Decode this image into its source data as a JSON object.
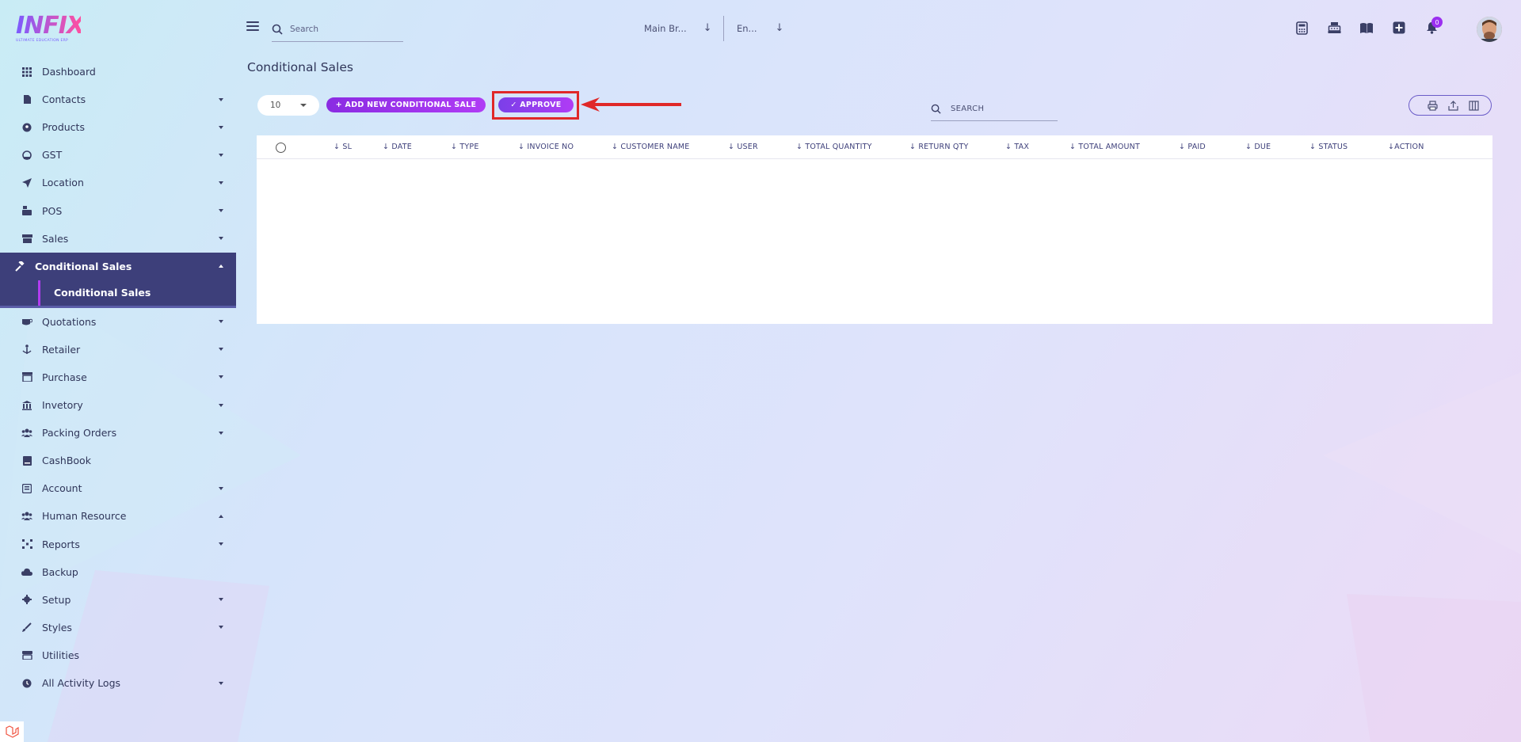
{
  "brand": {
    "name": "INFIX",
    "tagline": "ULTIMATE EDUCATION ERP"
  },
  "topbar": {
    "search_placeholder": "Search",
    "branch": "Main Br...",
    "language": "En...",
    "notification_count": "0",
    "icons": [
      "calculator-icon",
      "cash-register-icon",
      "book-icon",
      "plus-square-icon",
      "bell-icon"
    ]
  },
  "sidebar": {
    "items": [
      {
        "label": "Dashboard",
        "icon": "grid-icon",
        "has_caret": false
      },
      {
        "label": "Contacts",
        "icon": "contact-icon",
        "has_caret": true
      },
      {
        "label": "Products",
        "icon": "product-icon",
        "has_caret": true
      },
      {
        "label": "GST",
        "icon": "gst-icon",
        "has_caret": true
      },
      {
        "label": "Location",
        "icon": "location-icon",
        "has_caret": true
      },
      {
        "label": "POS",
        "icon": "pos-icon",
        "has_caret": true
      },
      {
        "label": "Sales",
        "icon": "sales-icon",
        "has_caret": true
      },
      {
        "label": "Conditional Sales",
        "icon": "gavel-icon",
        "active": true,
        "expanded": true
      },
      {
        "label": "Quotations",
        "icon": "quotation-icon",
        "has_caret": true
      },
      {
        "label": "Retailer",
        "icon": "retailer-icon",
        "has_caret": true
      },
      {
        "label": "Purchase",
        "icon": "purchase-icon",
        "has_caret": true
      },
      {
        "label": "Invetory",
        "icon": "inventory-icon",
        "has_caret": true
      },
      {
        "label": "Packing Orders",
        "icon": "users-icon",
        "has_caret": true
      },
      {
        "label": "CashBook",
        "icon": "cashbook-icon",
        "has_caret": false
      },
      {
        "label": "Account",
        "icon": "account-icon",
        "has_caret": true
      },
      {
        "label": "Human Resource",
        "icon": "users-icon",
        "has_caret": true,
        "caret_up": true
      },
      {
        "label": "Reports",
        "icon": "reports-icon",
        "has_caret": true
      },
      {
        "label": "Backup",
        "icon": "cloud-icon",
        "has_caret": false
      },
      {
        "label": "Setup",
        "icon": "gear-icon",
        "has_caret": true
      },
      {
        "label": "Styles",
        "icon": "brush-icon",
        "has_caret": true
      },
      {
        "label": "Utilities",
        "icon": "utilities-icon",
        "has_caret": false
      },
      {
        "label": "All Activity Logs",
        "icon": "clock-icon",
        "has_caret": true
      }
    ],
    "sub_item": "Conditional Sales"
  },
  "page": {
    "title": "Conditional Sales",
    "page_size": "10",
    "add_button": "+ ADD NEW CONDITIONAL SALE",
    "approve_button": "✓ APPROVE",
    "search_placeholder": "SEARCH"
  },
  "table": {
    "columns": [
      "↓ SL",
      "↓ DATE",
      "↓ TYPE",
      "↓ INVOICE NO",
      "↓ CUSTOMER NAME",
      "↓ USER",
      "↓ TOTAL QUANTITY",
      "↓ RETURN QTY",
      "↓ TAX",
      "↓ TOTAL AMOUNT",
      "↓ PAID",
      "↓ DUE",
      "↓ STATUS",
      "↓ACTION"
    ],
    "rows": []
  },
  "colors": {
    "accent": "#8a2be2",
    "sidebar_active": "#3d3f7a",
    "highlight": "#e02828"
  }
}
